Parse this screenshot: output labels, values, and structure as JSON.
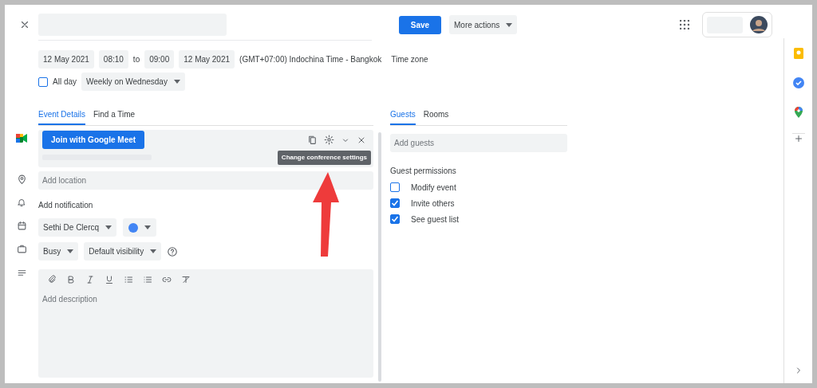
{
  "header": {
    "save": "Save",
    "more_actions": "More actions"
  },
  "schedule": {
    "start_date": "12 May 2021",
    "start_time": "08:10",
    "to": "to",
    "end_time": "09:00",
    "end_date": "12 May 2021",
    "timezone": "(GMT+07:00) Indochina Time - Bangkok",
    "timezone_link": "Time zone",
    "all_day": {
      "label": "All day",
      "checked": false
    },
    "recurrence": "Weekly on Wednesday"
  },
  "details_tabs": [
    {
      "label": "Event Details",
      "selected": true
    },
    {
      "label": "Find a Time",
      "selected": false
    }
  ],
  "conference": {
    "button": "Join with Google Meet",
    "tooltip": "Change conference settings"
  },
  "location": {
    "placeholder": "Add location"
  },
  "notification": "Add notification",
  "calendar": {
    "owner": "Sethi De Clercq",
    "color": "#4285f4"
  },
  "availability": {
    "status": "Busy",
    "visibility": "Default visibility"
  },
  "description": {
    "placeholder": "Add description"
  },
  "guest_tabs": [
    {
      "label": "Guests",
      "selected": true
    },
    {
      "label": "Rooms",
      "selected": false
    }
  ],
  "guests": {
    "placeholder": "Add guests"
  },
  "permissions": {
    "title": "Guest permissions",
    "items": [
      {
        "label": "Modify event",
        "checked": false
      },
      {
        "label": "Invite others",
        "checked": true
      },
      {
        "label": "See guest list",
        "checked": true
      }
    ]
  }
}
